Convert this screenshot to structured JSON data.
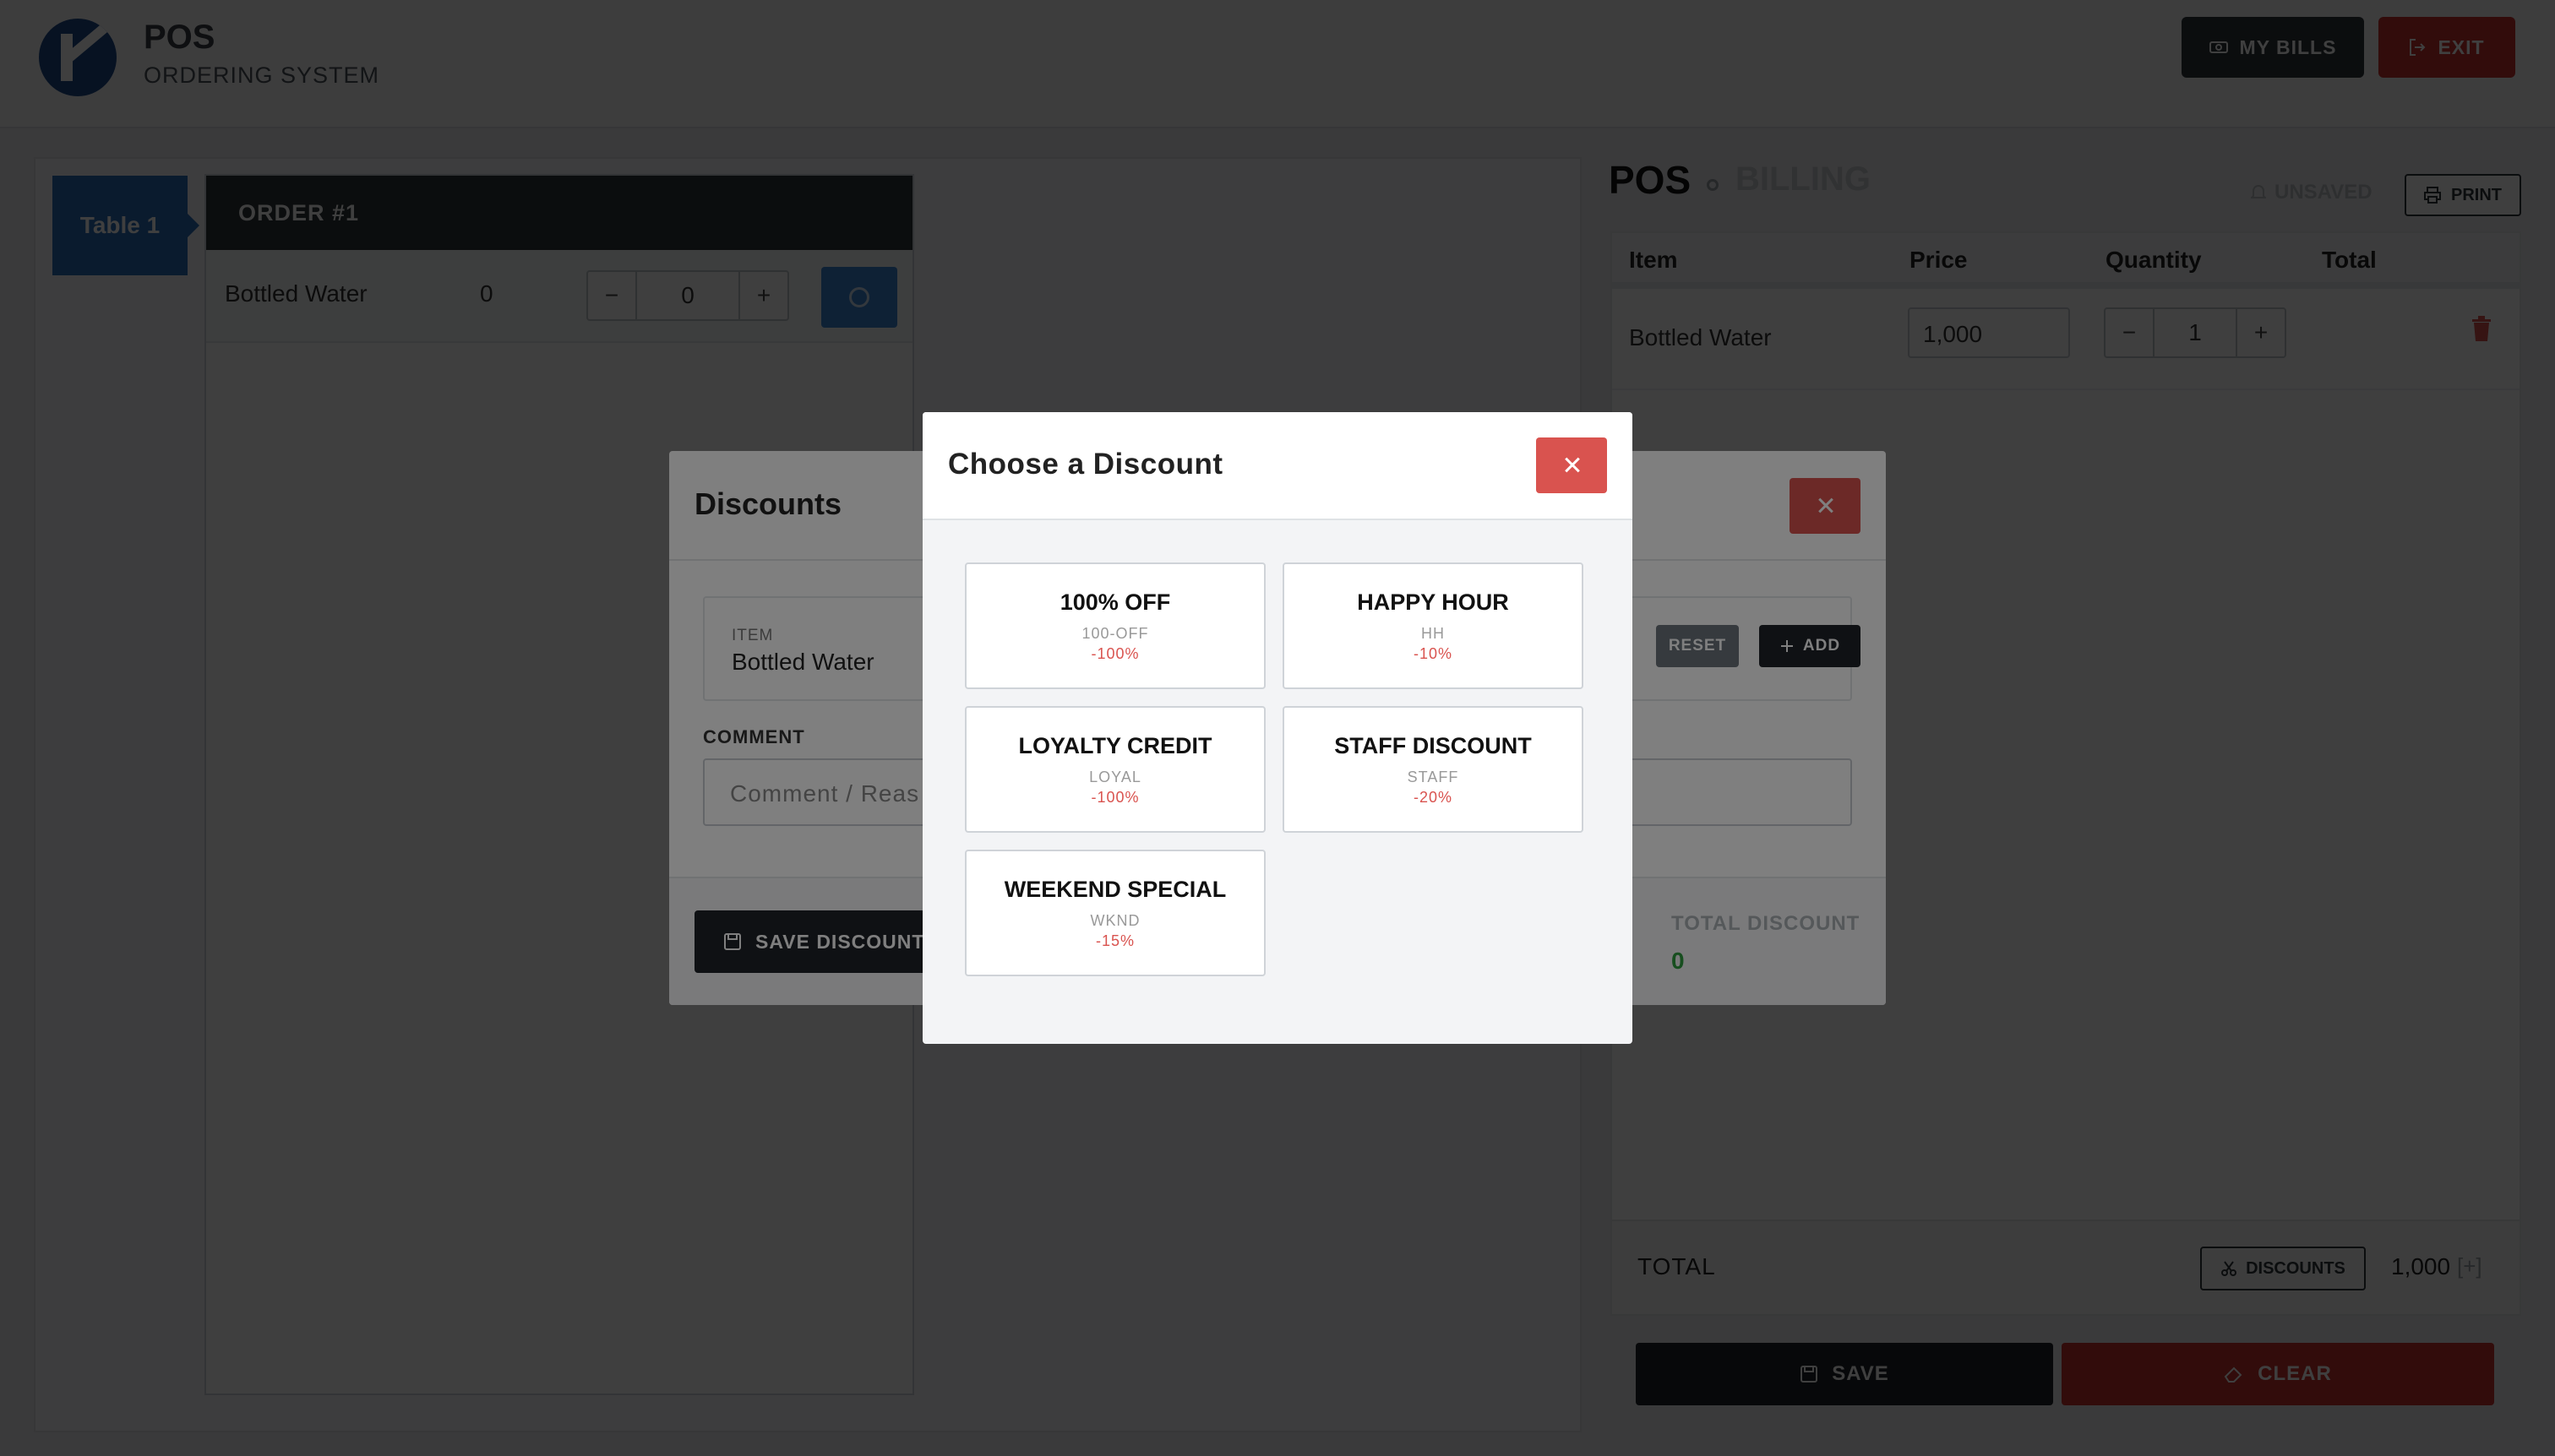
{
  "header": {
    "title": "POS",
    "subtitle": "ORDERING SYSTEM",
    "my_bills": "MY BILLS",
    "exit": "EXIT"
  },
  "order_panel": {
    "table_label": "Table 1",
    "order_title": "ORDER #1",
    "items": [
      {
        "name": "Bottled Water",
        "qty": "0",
        "stepper_value": "0",
        "minus": "−",
        "plus": "+"
      }
    ]
  },
  "billing": {
    "title": "POS",
    "subtitle": "BILLING",
    "status": "UNSAVED",
    "print": "PRINT",
    "columns": [
      "Item",
      "Price",
      "Quantity",
      "Total"
    ],
    "rows": [
      {
        "name": "Bottled Water",
        "price": "1,000",
        "qty": "1",
        "minus": "−",
        "plus": "+"
      }
    ],
    "total_label": "TOTAL",
    "discounts_button": "DISCOUNTS",
    "total_value": "1,000",
    "total_plus": "[+]",
    "save": "SAVE",
    "clear": "CLEAR"
  },
  "discounts_modal": {
    "title": "Discounts",
    "item_label": "ITEM",
    "item_value": "Bottled Water",
    "reset": "RESET",
    "add": "ADD",
    "comment_label": "COMMENT",
    "comment_placeholder": "Comment / Reas",
    "save_discounts": "SAVE DISCOUNTS",
    "total_discount_label": "TOTAL DISCOUNT",
    "total_discount_value": "0"
  },
  "choose_modal": {
    "title": "Choose a Discount",
    "options": [
      {
        "name": "100% OFF",
        "code": "100-OFF",
        "percent": "-100%"
      },
      {
        "name": "HAPPY HOUR",
        "code": "HH",
        "percent": "-10%"
      },
      {
        "name": "LOYALTY CREDIT",
        "code": "LOYAL",
        "percent": "-100%"
      },
      {
        "name": "STAFF DISCOUNT",
        "code": "STAFF",
        "percent": "-20%"
      },
      {
        "name": "WEEKEND SPECIAL",
        "code": "WKND",
        "percent": "-15%"
      }
    ]
  },
  "colors": {
    "dark": "#2e343a",
    "danger": "#d9534f",
    "primary": "#2b6cb8",
    "success": "#2e9c3f"
  }
}
